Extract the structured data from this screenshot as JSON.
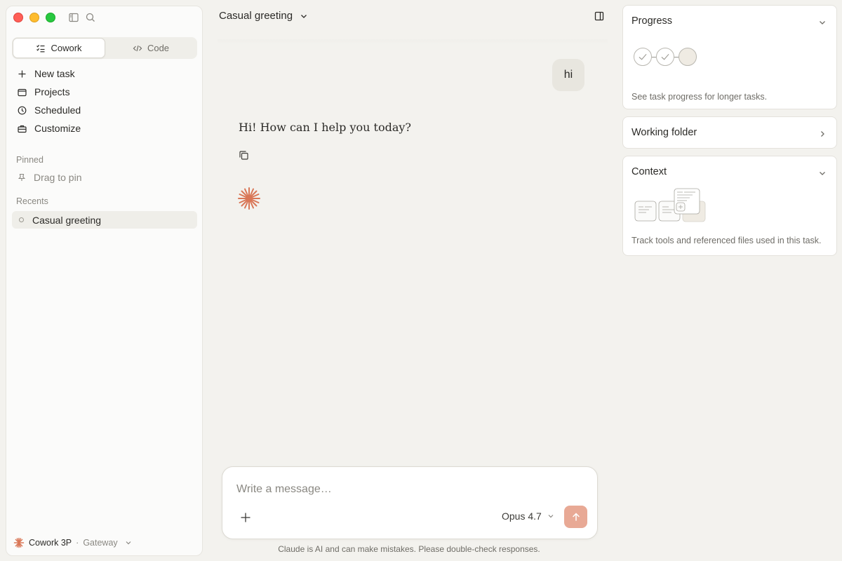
{
  "sidebar": {
    "modes": [
      {
        "label": "Cowork",
        "active": true
      },
      {
        "label": "Code",
        "active": false
      }
    ],
    "nav": [
      {
        "label": "New task",
        "icon": "plus-icon"
      },
      {
        "label": "Projects",
        "icon": "folder-icon"
      },
      {
        "label": "Scheduled",
        "icon": "clock-icon"
      },
      {
        "label": "Customize",
        "icon": "briefcase-icon"
      }
    ],
    "pinned_label": "Pinned",
    "pin_hint": "Drag to pin",
    "recents_label": "Recents",
    "recents": [
      {
        "label": "Casual greeting",
        "selected": true
      }
    ],
    "account": {
      "name": "Cowork 3P",
      "separator": "·",
      "org": "Gateway"
    }
  },
  "chat": {
    "title": "Casual greeting",
    "messages": [
      {
        "role": "user",
        "text": "hi"
      },
      {
        "role": "assistant",
        "text": "Hi! How can I help you today?"
      }
    ]
  },
  "composer": {
    "placeholder": "Write a message…",
    "value": "",
    "model": "Opus 4.7",
    "disclaimer": "Claude is AI and can make mistakes. Please double-check responses."
  },
  "panels": {
    "progress": {
      "title": "Progress",
      "description": "See task progress for longer tasks.",
      "steps": [
        "done",
        "done",
        "pending"
      ]
    },
    "working_folder": {
      "title": "Working folder"
    },
    "context": {
      "title": "Context",
      "description": "Track tools and referenced files used in this task."
    }
  },
  "colors": {
    "accent": "#d97757",
    "send_button": "#e8a995",
    "background": "#f3f2ee"
  }
}
